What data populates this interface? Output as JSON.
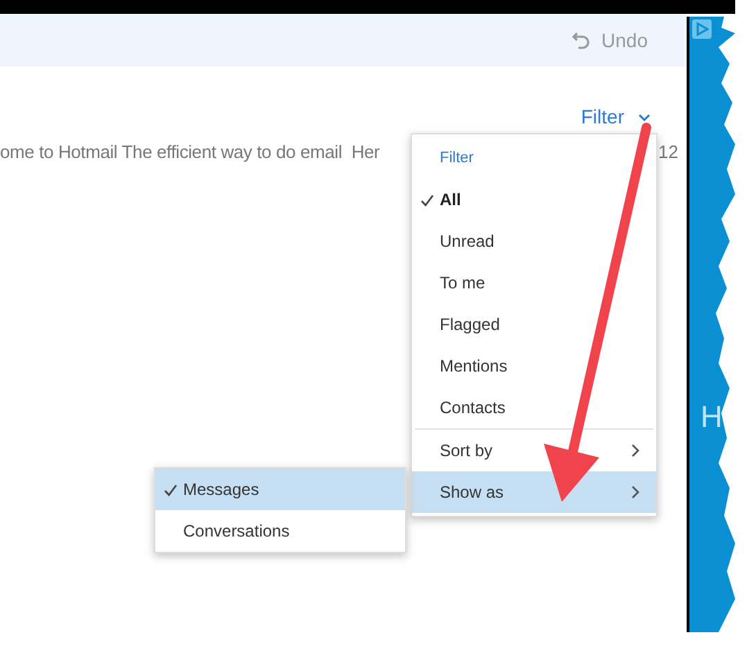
{
  "toolbar": {
    "undo_label": "Undo"
  },
  "filter_button": {
    "label": "Filter"
  },
  "message_row": {
    "preview": "ome to Hotmail The efficient way to do email  Her",
    "date": "12"
  },
  "filter_menu": {
    "heading": "Filter",
    "items": [
      {
        "kind": "option",
        "label": "All",
        "selected": true
      },
      {
        "kind": "option",
        "label": "Unread",
        "selected": false
      },
      {
        "kind": "option",
        "label": "To me",
        "selected": false
      },
      {
        "kind": "option",
        "label": "Flagged",
        "selected": false
      },
      {
        "kind": "option",
        "label": "Mentions",
        "selected": false
      },
      {
        "kind": "option",
        "label": "Contacts",
        "selected": false
      },
      {
        "kind": "submenu",
        "label": "Sort by",
        "expanded": false
      },
      {
        "kind": "submenu",
        "label": "Show as",
        "expanded": true
      }
    ]
  },
  "show_as_menu": {
    "items": [
      {
        "label": "Messages",
        "selected": true
      },
      {
        "label": "Conversations",
        "selected": false
      }
    ]
  },
  "side_panel": {
    "text": "H"
  }
}
